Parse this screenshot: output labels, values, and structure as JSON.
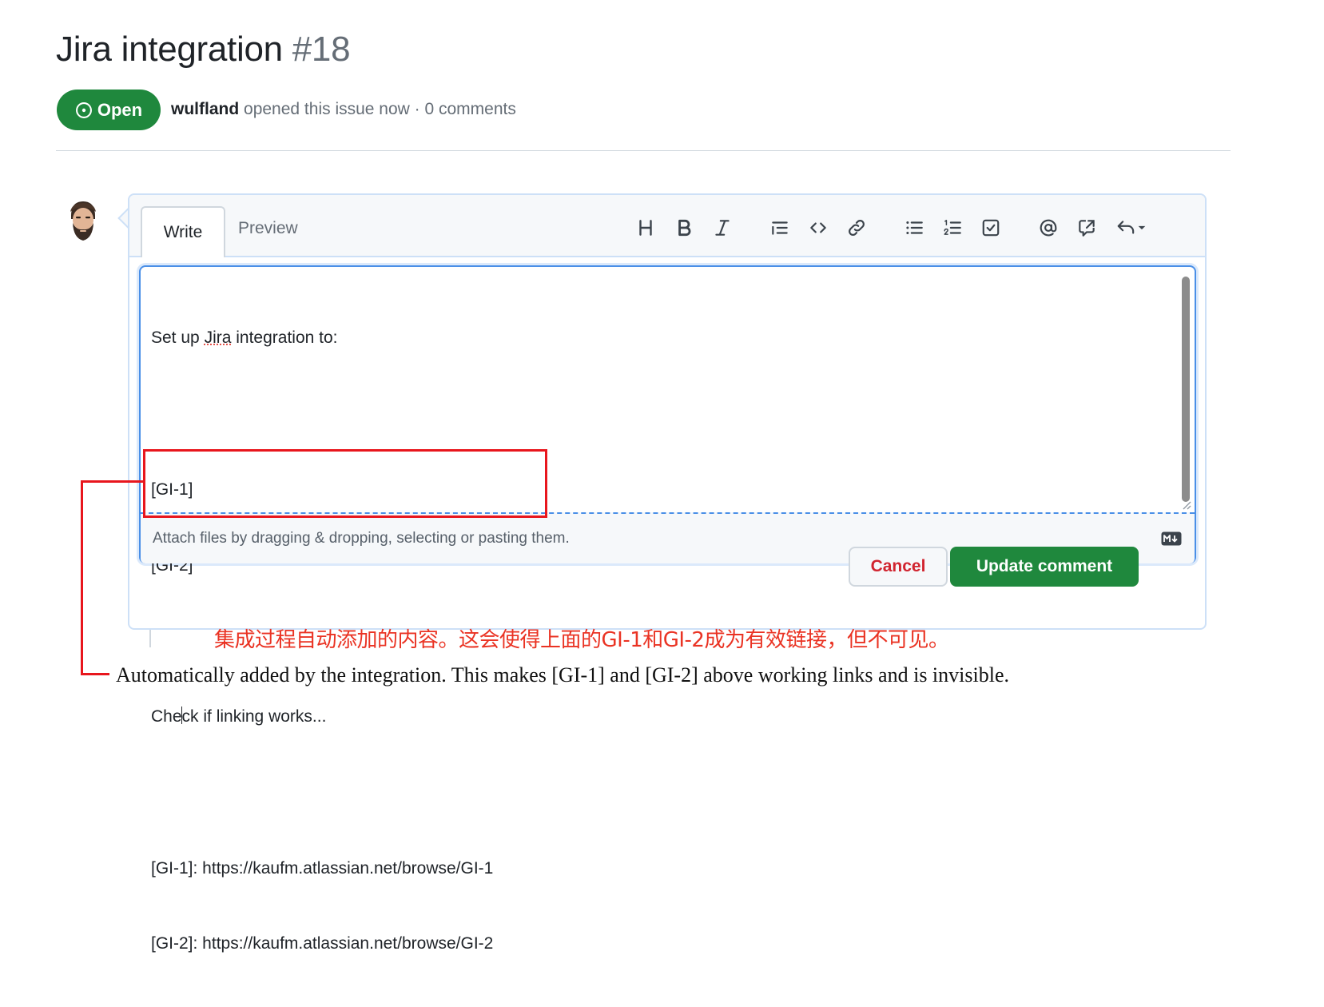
{
  "issue": {
    "title": "Jira integration",
    "number": "#18",
    "state_label": "Open",
    "author": "wulfland",
    "meta_text": "opened this issue now · 0 comments"
  },
  "comment_form": {
    "tabs": [
      {
        "label": "Write",
        "active": true
      },
      {
        "label": "Preview",
        "active": false
      }
    ],
    "toolbar_icons": [
      "heading-icon",
      "bold-icon",
      "italic-icon",
      "quote-icon",
      "code-icon",
      "link-icon",
      "unordered-list-icon",
      "ordered-list-icon",
      "task-list-icon",
      "mention-icon",
      "cross-reference-icon",
      "saved-replies-icon"
    ],
    "editor_lines": {
      "l1_pre": "Set up ",
      "l1_word": "Jira",
      "l1_post": " integration to:",
      "l3": "[GI-1]",
      "l4": "[GI-2]",
      "l6_pre": "Che",
      "l6_post": "ck if linking works...",
      "l8": "[GI-1]: https://kaufm.atlassian.net/browse/GI-1",
      "l9": "[GI-2]: https://kaufm.atlassian.net/browse/GI-2"
    },
    "attach_hint": "Attach files by dragging & dropping, selecting or pasting them.",
    "markdown_badge": "M↓",
    "cancel_label": "Cancel",
    "update_label": "Update comment"
  },
  "annotations": {
    "chinese_note": "集成过程自动添加的内容。这会使得上面的GI-1和GI-2成为有效链接，但不可见。",
    "english_note": "Automatically added by the integration. This makes [GI-1] and [GI-2] above working links and is invisible."
  },
  "colors": {
    "open_green": "#1f883d",
    "callout_red": "#e8161d",
    "focus_blue": "#4a8fe7"
  }
}
